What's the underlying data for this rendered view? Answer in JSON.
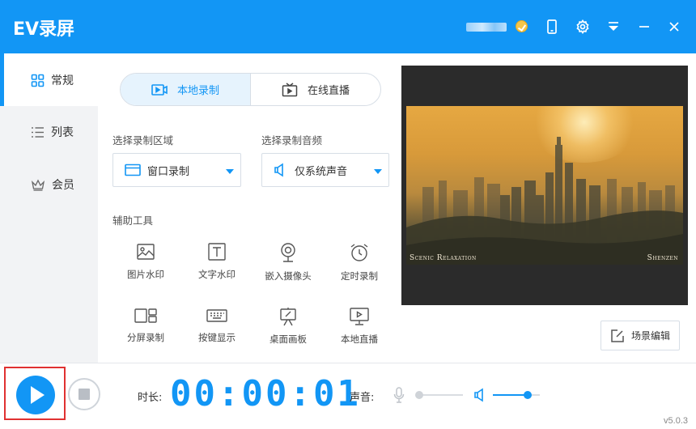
{
  "app": {
    "title": "EV录屏",
    "version": "v5.0.3"
  },
  "titlebar": {
    "icons": [
      "vip-badge-icon",
      "phone-icon",
      "gear-icon",
      "menu-down-icon",
      "minimize-icon",
      "close-icon"
    ]
  },
  "sidebar": {
    "items": [
      {
        "label": "常规",
        "icon": "grid-icon",
        "active": true
      },
      {
        "label": "列表",
        "icon": "list-icon",
        "active": false
      },
      {
        "label": "会员",
        "icon": "crown-icon",
        "active": false
      }
    ]
  },
  "mode": {
    "local": {
      "label": "本地录制",
      "icon": "video-camera-icon",
      "active": true
    },
    "online": {
      "label": "在线直播",
      "icon": "tv-icon",
      "active": false
    }
  },
  "record_area": {
    "label": "选择录制区域",
    "value": "窗口录制",
    "icon": "window-icon"
  },
  "record_audio": {
    "label": "选择录制音频",
    "value": "仅系统声音",
    "icon": "speaker-icon"
  },
  "tools": {
    "label": "辅助工具",
    "items": [
      {
        "label": "图片水印",
        "icon": "image-icon"
      },
      {
        "label": "文字水印",
        "icon": "text-icon"
      },
      {
        "label": "嵌入摄像头",
        "icon": "webcam-icon"
      },
      {
        "label": "定时录制",
        "icon": "alarm-clock-icon"
      },
      {
        "label": "分屏录制",
        "icon": "split-screen-icon"
      },
      {
        "label": "按键显示",
        "icon": "keyboard-icon"
      },
      {
        "label": "桌面画板",
        "icon": "easel-icon"
      },
      {
        "label": "本地直播",
        "icon": "monitor-play-icon"
      }
    ]
  },
  "preview": {
    "caption_left": "Scenic Relaxation",
    "caption_right": "Shenzen"
  },
  "scene_edit": {
    "label": "场景编辑",
    "icon": "edit-icon"
  },
  "bottom": {
    "duration_label": "时长:",
    "timer": "00:00:01",
    "sound_label": "声音:",
    "mic_level": 0,
    "system_level": 0.74,
    "accent": "#1296f5"
  }
}
